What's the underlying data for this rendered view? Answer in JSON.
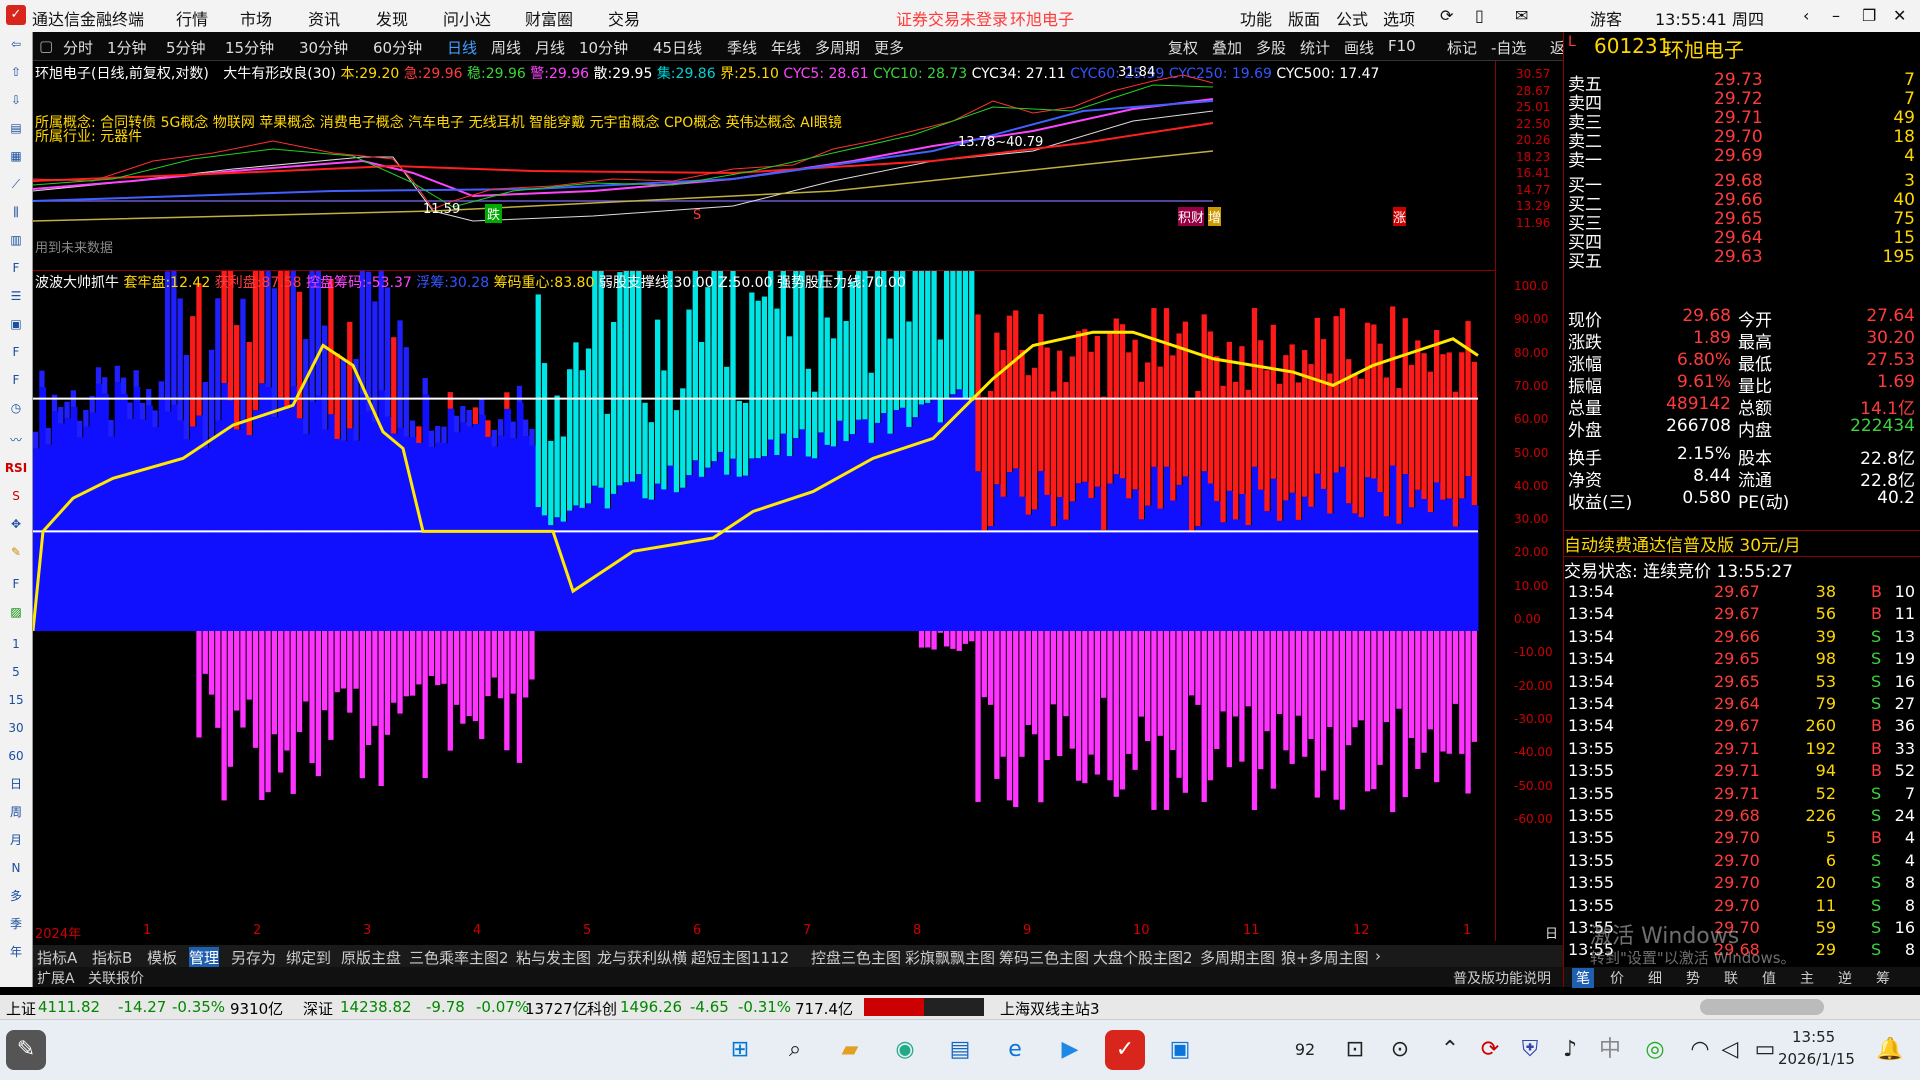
{
  "app": {
    "title": "通达信金融终端",
    "notice": "证券交易未登录",
    "stock_header": "环旭电子",
    "user": "游客",
    "clock": "13:55:41 周四"
  },
  "menus": [
    "行情",
    "市场",
    "资讯",
    "发现",
    "问小达",
    "财富圈",
    "交易"
  ],
  "top_right_menus": [
    "功能",
    "版面",
    "公式",
    "选项"
  ],
  "periods": [
    "分时",
    "1分钟",
    "5分钟",
    "15分钟",
    "30分钟",
    "60分钟",
    "日线",
    "周线",
    "月线",
    "10分钟",
    "45日线",
    "季线",
    "年线",
    "多周期",
    "更多"
  ],
  "active_period": "日线",
  "chart_tools": [
    "复权",
    "叠加",
    "多股",
    "统计",
    "画线",
    "F10",
    "标记",
    "-自选",
    "返回"
  ],
  "chart_title": {
    "name": "环旭电子(日线,前复权,对数)",
    "indicator": "大牛有形改良(30)",
    "ben_label": "本:",
    "ben": "29.20",
    "ji_label": "急:",
    "ji": "29.96",
    "wen_label": "稳:",
    "wen": "29.96",
    "jing_label": "警:",
    "jing": "29.96",
    "san_label": "散:",
    "san": "29.95",
    "ji2_label": "集:",
    "ji2": "29.86",
    "jie_label": "界:",
    "jie": "25.10",
    "cyc5": "CYC5: 28.61",
    "cyc10": "CYC10: 28.73",
    "cyc34": "CYC34: 27.11",
    "cyc60": "CYC60: 25.39",
    "cyc250": "CYC250: 19.69",
    "cyc500": "CYC500: 17.47"
  },
  "concepts": {
    "line1": "所属概念: 合同转债 5G概念 物联网 苹果概念 消费电子概念 汽车电子 无线耳机 智能穿戴 元宇宙概念 CPO概念 英伟达概念 AI眼镜",
    "line2": "所属行业: 元器件"
  },
  "future_note": "用到未来数据",
  "price_marks": {
    "high": "31.84",
    "low": "11.59",
    "mid": "13.78~40.79"
  },
  "markers": [
    "跌",
    "S",
    "积财",
    "增",
    "涨"
  ],
  "right_axis_main": [
    "30.57",
    "28.67",
    "25.01",
    "22.50",
    "20.26",
    "18.23",
    "16.41",
    "14.77",
    "13.29",
    "11.96"
  ],
  "sub_title": {
    "name": "波波大帅抓牛",
    "a_label": "套牢盘:",
    "a": "12.42",
    "b_label": "获利盘:",
    "b": "87.58",
    "c_label": "控盘筹码:",
    "c": "-53.37",
    "d_label": "浮筹:",
    "d": "30.28",
    "e_label": "筹码重心:",
    "e": "83.80",
    "f_label": "弱股支撑线:",
    "f": "30.00",
    "g_label": "Z:",
    "g": "50.00",
    "h_label": "强势股压力线:",
    "h": "70.00"
  },
  "right_axis_sub": [
    "100.0",
    "90.00",
    "80.00",
    "70.00",
    "60.00",
    "50.00",
    "40.00",
    "30.00",
    "20.00",
    "10.00",
    "0.00",
    "-10.00",
    "-20.00",
    "-30.00",
    "-40.00",
    "-50.00",
    "-60.00"
  ],
  "x_axis": [
    "2024年",
    "1",
    "2",
    "3",
    "4",
    "5",
    "6",
    "7",
    "8",
    "9",
    "10",
    "11",
    "12",
    "1"
  ],
  "x_period": "日线",
  "tabs": [
    "指标A",
    "指标B",
    "模板",
    "管理",
    "另存为",
    "绑定到",
    "原版主盘",
    "三色乘率主图2",
    "粘与发主图",
    "龙与获利纵横",
    "超短主图1112",
    "控盘三色主图",
    "彩旗飘飘主图",
    "筹码三色主图",
    "大盘个股主图2",
    "多周期主图",
    "狼+多周主图"
  ],
  "tabs2": [
    "扩展A",
    "关联报价"
  ],
  "tabs2_right": "普及版功能说明",
  "rp_tabs": [
    "笔",
    "价",
    "细",
    "势",
    "联",
    "值",
    "主",
    "逆",
    "筹"
  ],
  "quote": {
    "code": "601231",
    "name": "环旭电子",
    "asks": [
      {
        "l": "卖五",
        "p": "29.73",
        "v": "7"
      },
      {
        "l": "卖四",
        "p": "29.72",
        "v": "7"
      },
      {
        "l": "卖三",
        "p": "29.71",
        "v": "49"
      },
      {
        "l": "卖二",
        "p": "29.70",
        "v": "18"
      },
      {
        "l": "卖一",
        "p": "29.69",
        "v": "4"
      }
    ],
    "bids": [
      {
        "l": "买一",
        "p": "29.68",
        "v": "3"
      },
      {
        "l": "买二",
        "p": "29.66",
        "v": "40"
      },
      {
        "l": "买三",
        "p": "29.65",
        "v": "75"
      },
      {
        "l": "买四",
        "p": "29.64",
        "v": "15"
      },
      {
        "l": "买五",
        "p": "29.63",
        "v": "195"
      }
    ],
    "stats": [
      {
        "l1": "现价",
        "v1": "29.68",
        "l2": "今开",
        "v2": "27.64"
      },
      {
        "l1": "涨跌",
        "v1": "1.89",
        "l2": "最高",
        "v2": "30.20"
      },
      {
        "l1": "涨幅",
        "v1": "6.80%",
        "l2": "最低",
        "v2": "27.53"
      },
      {
        "l1": "振幅",
        "v1": "9.61%",
        "l2": "量比",
        "v2": "1.69"
      },
      {
        "l1": "总量",
        "v1": "489142",
        "l2": "总额",
        "v2": "14.1亿"
      },
      {
        "l1": "外盘",
        "v1": "266708",
        "l2": "内盘",
        "v2": "222434"
      },
      {
        "l1": "换手",
        "v1": "2.15%",
        "l2": "股本",
        "v2": "22.8亿"
      },
      {
        "l1": "净资",
        "v1": "8.44",
        "l2": "流通",
        "v2": "22.8亿"
      },
      {
        "l1": "收益(三)",
        "v1": "0.580",
        "l2": "PE(动)",
        "v2": "40.2"
      }
    ],
    "ad": "自动续费通达信普及版 30元/月",
    "trade_status": "交易状态: 连续竞价 13:55:27",
    "ticks": [
      [
        "13:54",
        "29.67",
        "38",
        "B",
        "10"
      ],
      [
        "13:54",
        "29.67",
        "56",
        "B",
        "11"
      ],
      [
        "13:54",
        "29.66",
        "39",
        "S",
        "13"
      ],
      [
        "13:54",
        "29.65",
        "98",
        "S",
        "19"
      ],
      [
        "13:54",
        "29.65",
        "53",
        "S",
        "16"
      ],
      [
        "13:54",
        "29.64",
        "79",
        "S",
        "27"
      ],
      [
        "13:54",
        "29.67",
        "260",
        "B",
        "36"
      ],
      [
        "13:55",
        "29.71",
        "192",
        "B",
        "33"
      ],
      [
        "13:55",
        "29.71",
        "94",
        "B",
        "52"
      ],
      [
        "13:55",
        "29.71",
        "52",
        "S",
        "7"
      ],
      [
        "13:55",
        "29.68",
        "226",
        "S",
        "24"
      ],
      [
        "13:55",
        "29.70",
        "5",
        "B",
        "4"
      ],
      [
        "13:55",
        "29.70",
        "6",
        "S",
        "4"
      ],
      [
        "13:55",
        "29.70",
        "20",
        "S",
        "8"
      ],
      [
        "13:55",
        "29.70",
        "11",
        "S",
        "8"
      ],
      [
        "13:55",
        "29.70",
        "59",
        "S",
        "16"
      ],
      [
        "13:55",
        "29.68",
        "29",
        "S",
        "8"
      ]
    ]
  },
  "status": {
    "sh": "上证",
    "sh_v": "4111.82",
    "sh_c": "-14.27",
    "sh_p": "-0.35%",
    "sh_a": "9310亿",
    "sz": "深证",
    "sz_v": "14238.82",
    "sz_c": "-9.78",
    "sz_p": "-0.07%",
    "sz_a": "13727亿",
    "kc": "科创",
    "kc_v": "1496.26",
    "kc_c": "-4.65",
    "kc_p": "-0.31%",
    "kc_a": "717.4亿",
    "site": "上海双线主站3"
  },
  "watermark": {
    "l1": "激活 Windows",
    "l2": "转到\"设置\"以激活 Windows。"
  },
  "taskbar": {
    "time": "13:55",
    "date": "2026/1/15",
    "badge": "92"
  },
  "left_labels": [
    "1",
    "5",
    "15",
    "30",
    "60",
    "日",
    "周",
    "月",
    "N",
    "多",
    "季",
    "年"
  ]
}
